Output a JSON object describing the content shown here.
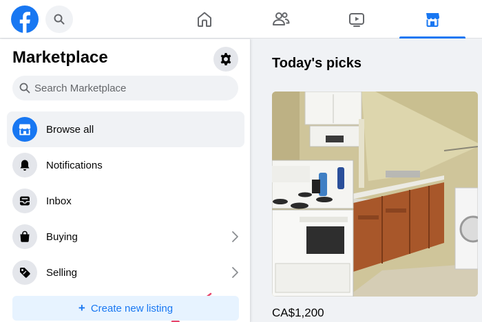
{
  "topbar": {
    "logo_icon": "facebook-logo-icon",
    "search_icon": "search-icon",
    "tabs": [
      {
        "name": "home",
        "icon": "home-icon",
        "active": false
      },
      {
        "name": "friends",
        "icon": "friends-icon",
        "active": false
      },
      {
        "name": "watch",
        "icon": "watch-icon",
        "active": false
      },
      {
        "name": "marketplace",
        "icon": "marketplace-icon",
        "active": true
      }
    ]
  },
  "sidebar": {
    "title": "Marketplace",
    "settings_icon": "gear-icon",
    "search_placeholder": "Search Marketplace",
    "items": [
      {
        "label": "Browse all",
        "icon": "storefront-icon",
        "active": true,
        "chevron": false
      },
      {
        "label": "Notifications",
        "icon": "bell-icon",
        "active": false,
        "chevron": false
      },
      {
        "label": "Inbox",
        "icon": "inbox-icon",
        "active": false,
        "chevron": false
      },
      {
        "label": "Buying",
        "icon": "shopping-bag-icon",
        "active": false,
        "chevron": true
      },
      {
        "label": "Selling",
        "icon": "price-tag-icon",
        "active": false,
        "chevron": true
      }
    ],
    "create_listing_label": "Create new listing"
  },
  "main": {
    "section_title": "Today's picks",
    "listings": [
      {
        "price": "CA$1,200"
      }
    ]
  },
  "colors": {
    "brand": "#1877f2",
    "annotation_arrow": "#e8456a"
  }
}
